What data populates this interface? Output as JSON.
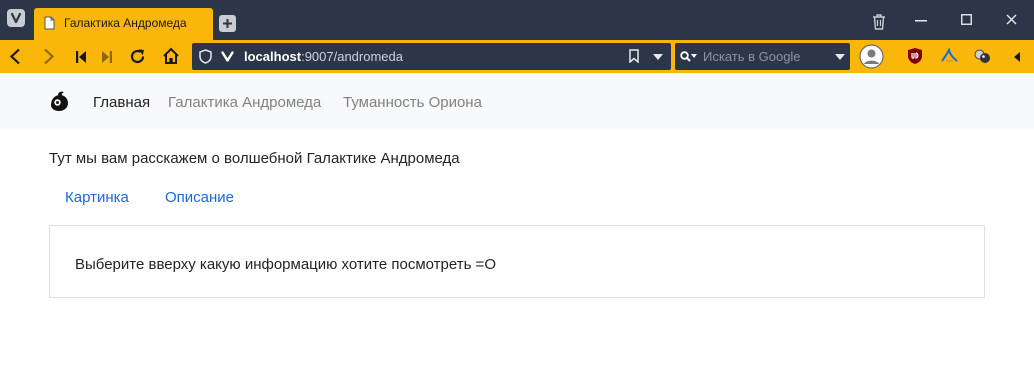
{
  "browser": {
    "tab_title": "Галактика Андромеда",
    "url_host": "localhost",
    "url_rest": ":9007/andromeda",
    "search_placeholder": "Искать в Google",
    "accent": "#fbb709",
    "chrome_dark": "#2c3648"
  },
  "navbar": {
    "items": [
      {
        "label": "Главная",
        "active": true
      },
      {
        "label": "Галактика Андромеда",
        "active": false
      },
      {
        "label": "Туманность Ориона",
        "active": false
      }
    ]
  },
  "main": {
    "intro": "Тут мы вам расскажем о волшебной Галактике Андромеда",
    "tabs": [
      {
        "label": "Картинка"
      },
      {
        "label": "Описание"
      }
    ],
    "panel_text": "Выберите вверху какую информацию хотите посмотреть =O",
    "link_color": "#1b6ad7"
  }
}
